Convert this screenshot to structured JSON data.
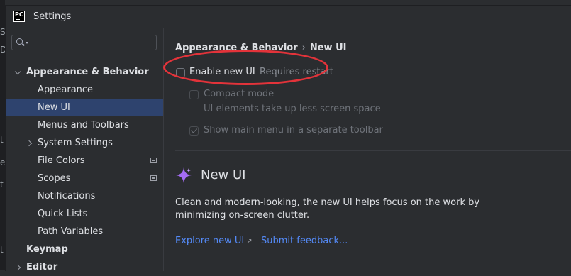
{
  "window": {
    "title": "Settings",
    "app_icon": "PC"
  },
  "behind": [
    "S",
    "D",
    "t",
    "e",
    "t",
    "t"
  ],
  "search": {
    "placeholder": "",
    "value": ""
  },
  "sidebar": {
    "items": [
      {
        "label": "Appearance & Behavior",
        "bold": true,
        "expand": "down",
        "indent": 0
      },
      {
        "label": "Appearance",
        "indent": 1
      },
      {
        "label": "New UI",
        "indent": 1,
        "selected": true
      },
      {
        "label": "Menus and Toolbars",
        "indent": 1
      },
      {
        "label": "System Settings",
        "indent": 1,
        "expand": "right"
      },
      {
        "label": "File Colors",
        "indent": 1,
        "project_icon": true
      },
      {
        "label": "Scopes",
        "indent": 1,
        "project_icon": true
      },
      {
        "label": "Notifications",
        "indent": 1
      },
      {
        "label": "Quick Lists",
        "indent": 1
      },
      {
        "label": "Path Variables",
        "indent": 1
      },
      {
        "label": "Keymap",
        "bold": true,
        "indent": 0
      },
      {
        "label": "Editor",
        "bold": true,
        "expand": "right",
        "indent": 0
      }
    ]
  },
  "breadcrumb": {
    "parent": "Appearance & Behavior",
    "separator": "›",
    "current": "New UI"
  },
  "options": {
    "enable_new_ui": {
      "label": "Enable new UI",
      "hint": "Requires restart",
      "checked": false
    },
    "compact_mode": {
      "label": "Compact mode",
      "hint": "UI elements take up less screen space",
      "checked": false
    },
    "show_main_menu": {
      "label": "Show main menu in a separate toolbar",
      "checked": true
    }
  },
  "promo": {
    "title": "New UI",
    "description": "Clean and modern-looking, the new UI helps focus on the work by minimizing on-screen clutter.",
    "explore_link": "Explore new UI",
    "feedback_link": "Submit feedback..."
  },
  "colors": {
    "accent_link": "#548af7",
    "selection": "#2e436e",
    "annotation": "#e3333a",
    "sparkle": "#a46cf5"
  }
}
